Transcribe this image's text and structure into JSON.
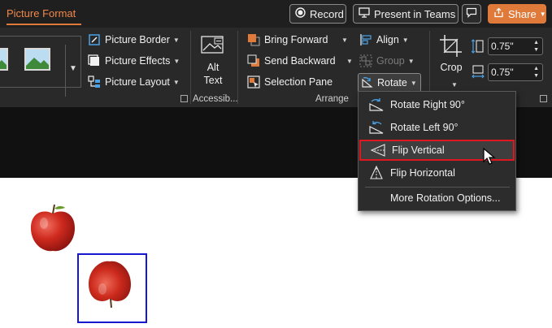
{
  "tabbar": {
    "active_tab": "Picture Format",
    "record_label": "Record",
    "present_label": "Present in Teams",
    "share_label": "Share"
  },
  "ribbon": {
    "styles": {
      "border_label": "Picture Border",
      "effects_label": "Picture Effects",
      "layout_label": "Picture Layout"
    },
    "accessibility": {
      "alt_text_line1": "Alt",
      "alt_text_line2": "Text",
      "group_label": "Accessib..."
    },
    "arrange": {
      "bring_forward": "Bring Forward",
      "send_backward": "Send Backward",
      "selection_pane": "Selection Pane",
      "align": "Align",
      "group": "Group",
      "rotate": "Rotate",
      "group_label": "Arrange"
    },
    "size": {
      "crop_label": "Crop",
      "height_value": "0.75\"",
      "width_value": "0.75\""
    }
  },
  "rotate_menu": {
    "items": [
      {
        "label": "Rotate Right 90°",
        "icon": "rotate-right-icon"
      },
      {
        "label": "Rotate Left 90°",
        "icon": "rotate-left-icon"
      },
      {
        "label": "Flip Vertical",
        "icon": "flip-vertical-icon",
        "highlighted": true
      },
      {
        "label": "Flip Horizontal",
        "icon": "flip-horizontal-icon"
      },
      {
        "label": "More Rotation Options...",
        "icon": ""
      }
    ]
  },
  "colors": {
    "accent": "#e07a3a",
    "highlight_border": "#e0181e",
    "selection_border": "#1518d0"
  }
}
